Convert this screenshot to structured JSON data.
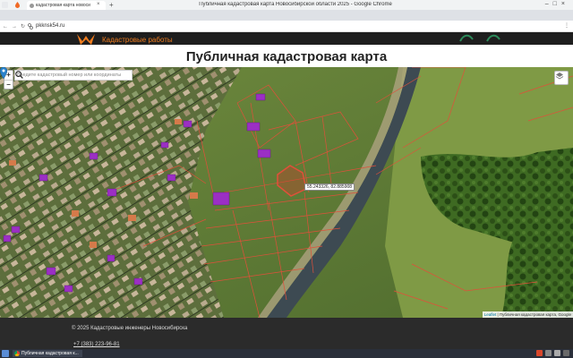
{
  "browser": {
    "window_title": "Публичная кадастровая карта Новосибирской области 2025 - Google Chrome",
    "tab_title": "кадастровая карта новоси",
    "tab_close": "×",
    "new_tab": "+",
    "window_controls": "–□×",
    "url": "pkknsk54.ru",
    "nav_glyphs": "←→↻",
    "menu_glyph": "⋮"
  },
  "site": {
    "logo_text": "Кадастровые работы",
    "page_title": "Публичная кадастровая карта"
  },
  "map": {
    "zoom_in": "+",
    "zoom_out": "−",
    "search_placeholder": "Введите кадастровый номер или координаты",
    "coordinates": "55.243326, 82.885908",
    "attribution_leaflet": "Leaflet",
    "attribution_rest": " | Публичная кадастровая карта, Google",
    "colors": {
      "parcel_line": "#e0503a",
      "selected_fill": "#d23a2a",
      "building": "#9b2fc4",
      "river": "#3d4a52"
    }
  },
  "footer": {
    "copyright": "© 2025 Кадастровые инженеры Новосибирска",
    "phone": "+7 (383) 223-96-81"
  },
  "taskbar": {
    "item_label": "Публичная кадастровая к..."
  }
}
